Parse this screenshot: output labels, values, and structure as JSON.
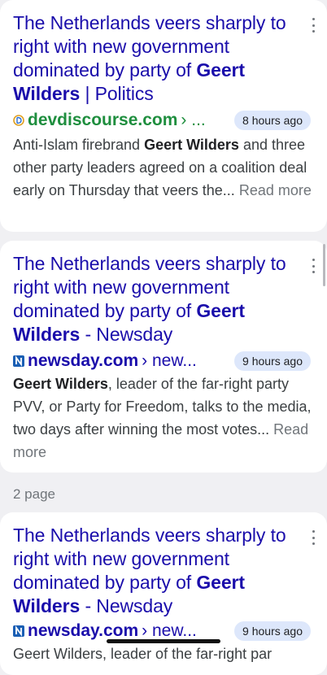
{
  "results": [
    {
      "title_pre": "The Netherlands veers sharply to right with new government dominated by party of ",
      "title_bold": "Geert Wilders",
      "title_post": " | Politics",
      "site": "devdiscourse.com",
      "path": "› ...",
      "time": "8 hours ago",
      "snippet_pre": "Anti-Islam firebrand ",
      "snippet_bold": "Geert Wilders",
      "snippet_post": " and three other party leaders agreed on a coalition deal early on Thursday that veers the... ",
      "read_more": "Read more",
      "favicon": "devdiscourse-logo-icon"
    },
    {
      "title_pre": "The Netherlands veers sharply to right with new government dominated by party of ",
      "title_bold": "Geert",
      "title_mid": " Wilders",
      "title_post": " - Newsday",
      "site": "newsday.com",
      "path": "› new...",
      "time": "9 hours ago",
      "snippet_pre": "",
      "snippet_bold": "Geert Wilders",
      "snippet_post": ", leader of the far-right party PVV, or Party for Freedom, talks to the media, two days after winning the most votes... ",
      "read_more": "Read more",
      "favicon": "newsday-logo-icon"
    },
    {
      "title_pre": "The Netherlands veers sharply to right with new government dominated by party of ",
      "title_bold": "Geert",
      "title_mid": " Wilders",
      "title_post": " - Newsday",
      "site": "newsday.com",
      "path": "› new...",
      "time": "9 hours ago",
      "snippet_partial": "Geert Wilders, leader of the far-right par",
      "favicon": "newsday-logo-icon"
    }
  ],
  "page_label": "2 page",
  "colors": {
    "title": "#1a0dab",
    "site_green": "#1e8e3e",
    "badge_bg": "#dde7fb",
    "background": "#f0f0f3"
  }
}
